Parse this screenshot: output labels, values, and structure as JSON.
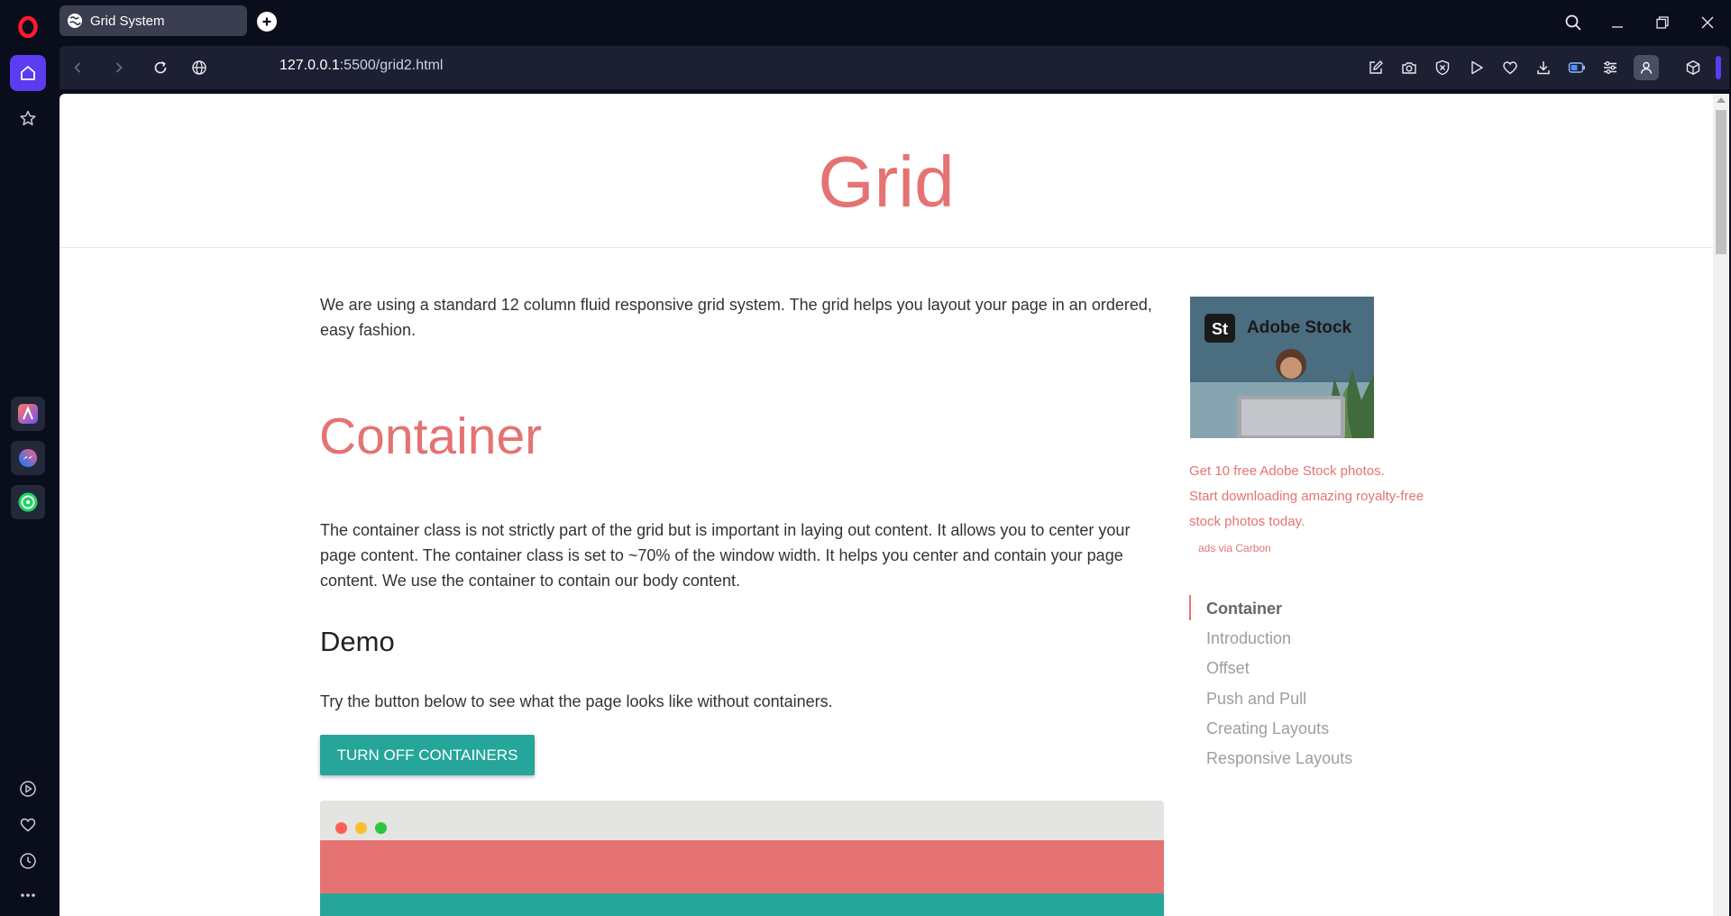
{
  "browser": {
    "tab_title": "Grid System",
    "url_host": "127.0.0.1",
    "url_rest": ":5500/grid2.html"
  },
  "page": {
    "title": "Grid",
    "intro": "We are using a standard 12 column fluid responsive grid system. The grid helps you layout your page in an ordered, easy fashion.",
    "container_heading": "Container",
    "container_text": "The container class is not strictly part of the grid but is important in laying out content. It allows you to center your page content. The container class is set to ~70% of the window width. It helps you center and contain your page content. We use the container to contain our body content.",
    "demo_heading": "Demo",
    "demo_text": "Try the button below to see what the page looks like without containers.",
    "toggle_button": "TURN OFF CONTAINERS"
  },
  "ad": {
    "brand_badge": "St",
    "brand": "Adobe Stock",
    "line1": "Get 10 free Adobe Stock photos.",
    "line2": "Start downloading amazing royalty-free",
    "line3": "stock photos today.",
    "via": "ads via Carbon"
  },
  "toc": {
    "items": [
      "Container",
      "Introduction",
      "Offset",
      "Push and Pull",
      "Creating Layouts",
      "Responsive Layouts"
    ]
  },
  "colors": {
    "accent": "#e57373",
    "teal": "#26a69a",
    "opera_purple": "#5b3cf0"
  }
}
